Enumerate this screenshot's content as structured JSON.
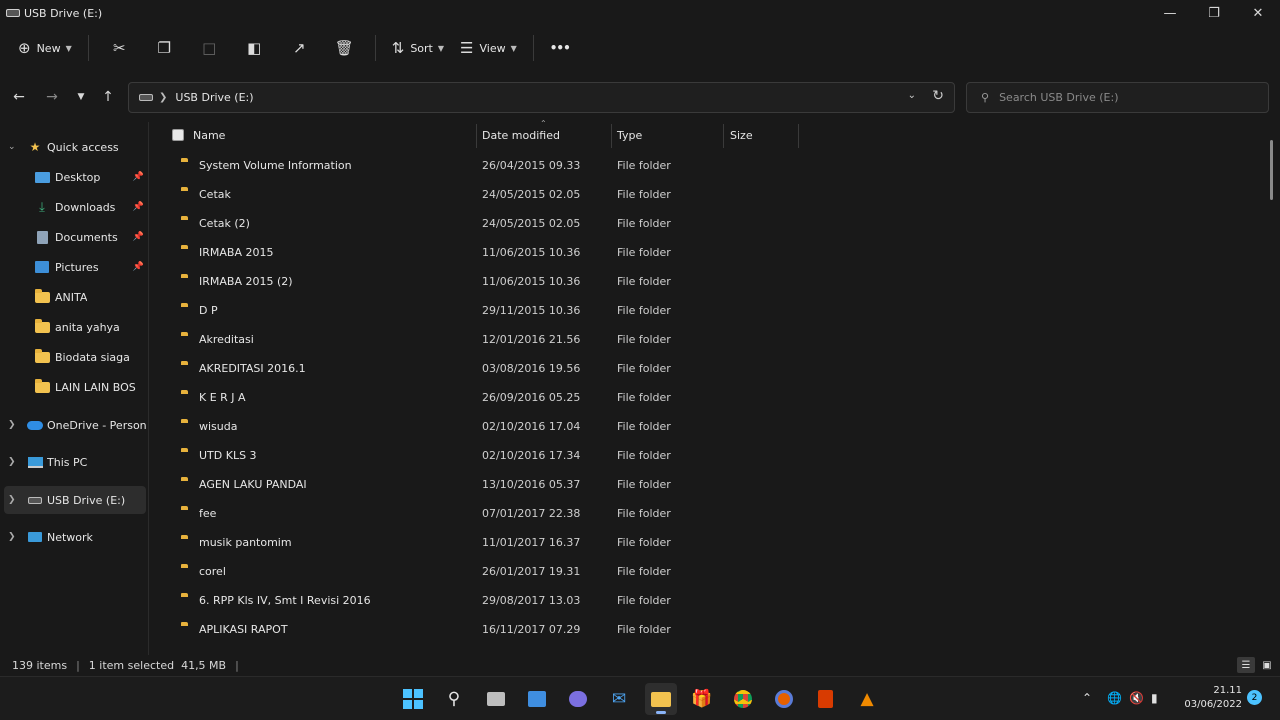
{
  "window": {
    "title": "USB Drive (E:)"
  },
  "toolbar": {
    "new_label": "New",
    "sort_label": "Sort",
    "view_label": "View",
    "more_label": "•••"
  },
  "address": {
    "path": "USB Drive (E:)"
  },
  "search": {
    "placeholder": "Search USB Drive (E:)"
  },
  "sidebar": {
    "quick_access": "Quick access",
    "pinned": [
      {
        "label": "Desktop",
        "icon": "desktop-icon"
      },
      {
        "label": "Downloads",
        "icon": "download-icon"
      },
      {
        "label": "Documents",
        "icon": "documents-icon"
      },
      {
        "label": "Pictures",
        "icon": "pictures-icon"
      }
    ],
    "folders": [
      "ANITA",
      "anita yahya",
      "Biodata siaga",
      "LAIN LAIN BOS"
    ],
    "onedrive": "OneDrive - Personal",
    "this_pc": "This PC",
    "usb": "USB Drive (E:)",
    "network": "Network"
  },
  "columns": {
    "name": "Name",
    "date": "Date modified",
    "type": "Type",
    "size": "Size"
  },
  "files": [
    {
      "name": "System Volume Information",
      "date": "26/04/2015 09.33",
      "type": "File folder"
    },
    {
      "name": "Cetak",
      "date": "24/05/2015 02.05",
      "type": "File folder"
    },
    {
      "name": "Cetak (2)",
      "date": "24/05/2015 02.05",
      "type": "File folder"
    },
    {
      "name": "IRMABA 2015",
      "date": "11/06/2015 10.36",
      "type": "File folder"
    },
    {
      "name": "IRMABA 2015 (2)",
      "date": "11/06/2015 10.36",
      "type": "File folder"
    },
    {
      "name": "D P",
      "date": "29/11/2015 10.36",
      "type": "File folder"
    },
    {
      "name": "Akreditasi",
      "date": "12/01/2016 21.56",
      "type": "File folder"
    },
    {
      "name": "AKREDITASI 2016.1",
      "date": "03/08/2016 19.56",
      "type": "File folder"
    },
    {
      "name": "K E R J A",
      "date": "26/09/2016 05.25",
      "type": "File folder"
    },
    {
      "name": "wisuda",
      "date": "02/10/2016 17.04",
      "type": "File folder"
    },
    {
      "name": "UTD KLS 3",
      "date": "02/10/2016 17.34",
      "type": "File folder"
    },
    {
      "name": "AGEN LAKU PANDAI",
      "date": "13/10/2016 05.37",
      "type": "File folder"
    },
    {
      "name": "fee",
      "date": "07/01/2017 22.38",
      "type": "File folder"
    },
    {
      "name": "musik pantomim",
      "date": "11/01/2017 16.37",
      "type": "File folder"
    },
    {
      "name": "corel",
      "date": "26/01/2017 19.31",
      "type": "File folder"
    },
    {
      "name": "6. RPP Kls IV, Smt I Revisi 2016",
      "date": "29/08/2017 13.03",
      "type": "File folder"
    },
    {
      "name": "APLIKASI RAPOT",
      "date": "16/11/2017 07.29",
      "type": "File folder"
    }
  ],
  "status": {
    "items": "139 items",
    "selected": "1 item selected  41,5 MB"
  },
  "taskbar": {
    "time": "21.11",
    "date": "03/06/2022",
    "notifications": "2"
  },
  "colors": {
    "folder": "#f2c24f",
    "accent": "#4cc2ff",
    "background": "#191919"
  }
}
